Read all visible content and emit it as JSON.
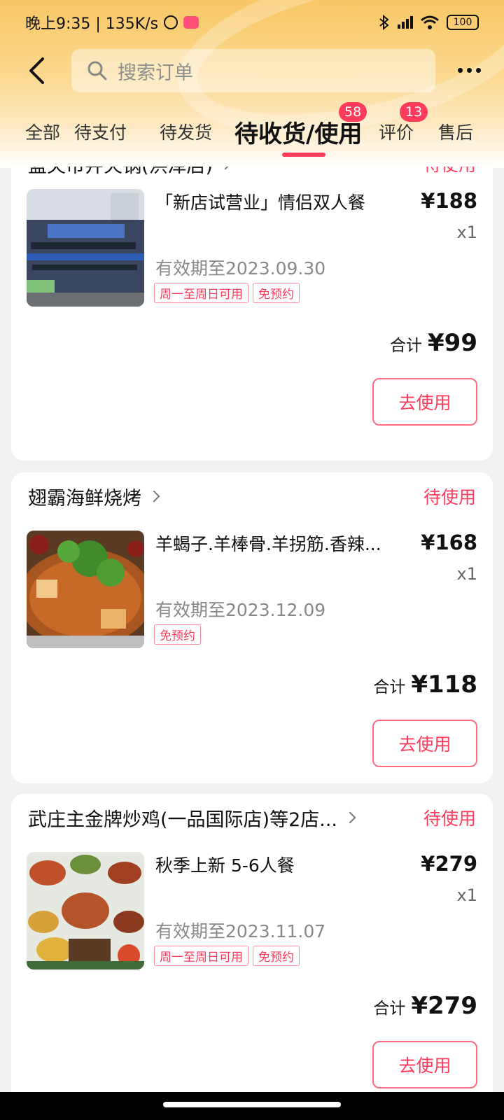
{
  "status_bar": {
    "time": "晚上9:35 | 135K/s",
    "battery": "100"
  },
  "search": {
    "placeholder": "搜索订单"
  },
  "tabs": [
    {
      "label": "全部"
    },
    {
      "label": "待支付"
    },
    {
      "label": "待发货"
    },
    {
      "label": "待收货/使用",
      "badge": "58",
      "active": true
    },
    {
      "label": "评价",
      "badge": "13"
    },
    {
      "label": "售后"
    }
  ],
  "orders": [
    {
      "shop": "蓝夫市井火锅(洪泽店)",
      "status": "待使用",
      "product": "「新店试营业」情侣双人餐",
      "price": "¥188",
      "qty": "x1",
      "validity": "有效期至2023.09.30",
      "tags": [
        "周一至周日可用",
        "免预约"
      ],
      "total_label": "合计",
      "total": "¥99",
      "button": "去使用",
      "image_icon": "restaurant-storefront"
    },
    {
      "shop": "翅霸海鲜烧烤",
      "status": "待使用",
      "product": "羊蝎子.羊棒骨.羊拐筋.香辣...",
      "price": "¥168",
      "qty": "x1",
      "validity": "有效期至2023.12.09",
      "tags": [
        "免预约"
      ],
      "total_label": "合计",
      "total": "¥118",
      "button": "去使用",
      "image_icon": "hotpot-dish"
    },
    {
      "shop": "武庄主金牌炒鸡(一品国际店)等2店...",
      "status": "待使用",
      "product": "秋季上新 5-6人餐",
      "price": "¥279",
      "qty": "x1",
      "validity": "有效期至2023.11.07",
      "tags": [
        "周一至周日可用",
        "免预约"
      ],
      "total_label": "合计",
      "total": "¥279",
      "button": "去使用",
      "image_icon": "set-meal-dishes"
    }
  ]
}
